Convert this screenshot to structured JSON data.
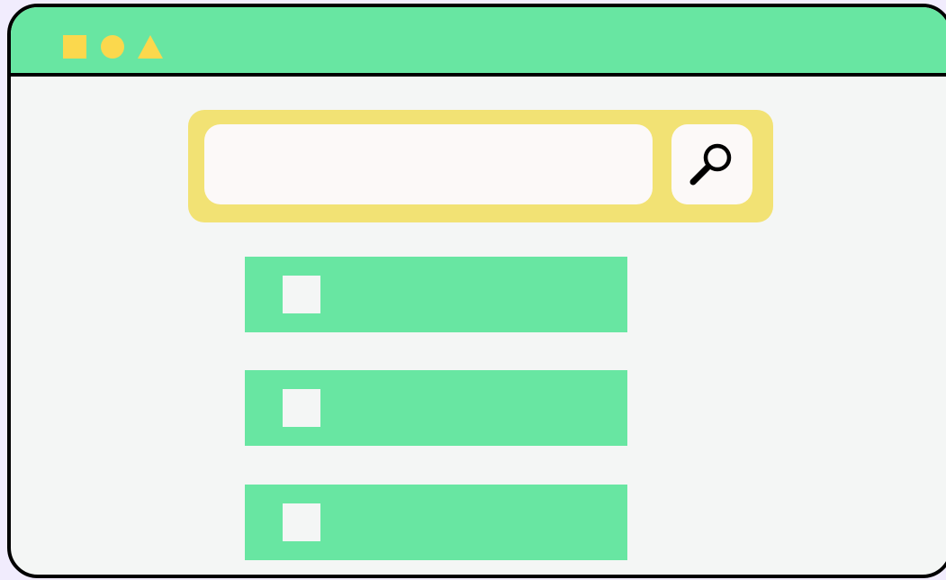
{
  "window": {
    "title": "",
    "controls": [
      {
        "name": "square-control",
        "shape": "square"
      },
      {
        "name": "circle-control",
        "shape": "circle"
      },
      {
        "name": "triangle-control",
        "shape": "triangle"
      }
    ]
  },
  "search": {
    "value": "",
    "placeholder": "",
    "button_icon": "search-icon"
  },
  "list": {
    "items": [
      {
        "label": "",
        "checked": false
      },
      {
        "label": "",
        "checked": false
      },
      {
        "label": "",
        "checked": false
      }
    ]
  },
  "colors": {
    "background": "#f1ecfd",
    "window_body": "#f4f6f5",
    "titlebar": "#68e6a2",
    "controls": "#fbd84d",
    "search_bar": "#f2e274",
    "input": "#fcf9f8",
    "list_item": "#68e6a2",
    "border": "#000000"
  }
}
